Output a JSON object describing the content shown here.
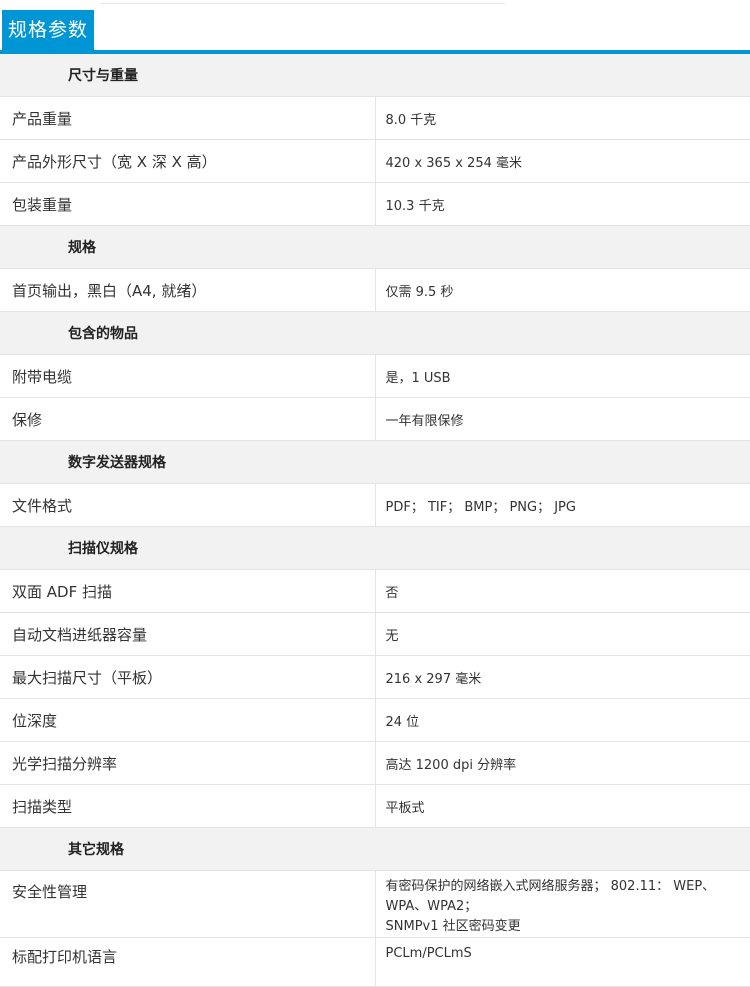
{
  "tab": {
    "label": "规格参数"
  },
  "colors": {
    "accent": "#0096d6",
    "group_bg": "#f2f2f2",
    "border": "#e4e4e4"
  },
  "groups": [
    {
      "title": "尺寸与重量",
      "rows": [
        {
          "label": "产品重量",
          "value": "8.0 千克"
        },
        {
          "label": "产品外形尺寸（宽 X 深 X 高）",
          "value": "420 x 365 x 254 毫米"
        },
        {
          "label": "包装重量",
          "value": "10.3 千克"
        }
      ]
    },
    {
      "title": "规格",
      "rows": [
        {
          "label": "首页输出，黑白（A4, 就绪）",
          "value": "仅需 9.5 秒"
        }
      ]
    },
    {
      "title": "包含的物品",
      "rows": [
        {
          "label": "附带电缆",
          "value": "是，1 USB"
        },
        {
          "label": "保修",
          "value": "一年有限保修"
        }
      ]
    },
    {
      "title": "数字发送器规格",
      "rows": [
        {
          "label": "文件格式",
          "value": "PDF； TIF； BMP； PNG； JPG"
        }
      ]
    },
    {
      "title": "扫描仪规格",
      "rows": [
        {
          "label": "双面 ADF 扫描",
          "value": "否"
        },
        {
          "label": "自动文档进纸器容量",
          "value": "无"
        },
        {
          "label": "最大扫描尺寸（平板）",
          "value": "216 x 297 毫米"
        },
        {
          "label": "位深度",
          "value": "24 位"
        },
        {
          "label": "光学扫描分辨率",
          "value": "高达 1200 dpi 分辨率"
        },
        {
          "label": "扫描类型",
          "value": "平板式"
        }
      ]
    },
    {
      "title": "其它规格",
      "rows": [
        {
          "label": "安全性管理",
          "value_line1": "有密码保护的网络嵌入式网络服务器； 802.11： WEP、WPA、WPA2；",
          "value_line2": "SNMPv1 社区密码变更"
        },
        {
          "label": "标配打印机语言",
          "value": "PCLm/PCLmS"
        }
      ]
    }
  ]
}
